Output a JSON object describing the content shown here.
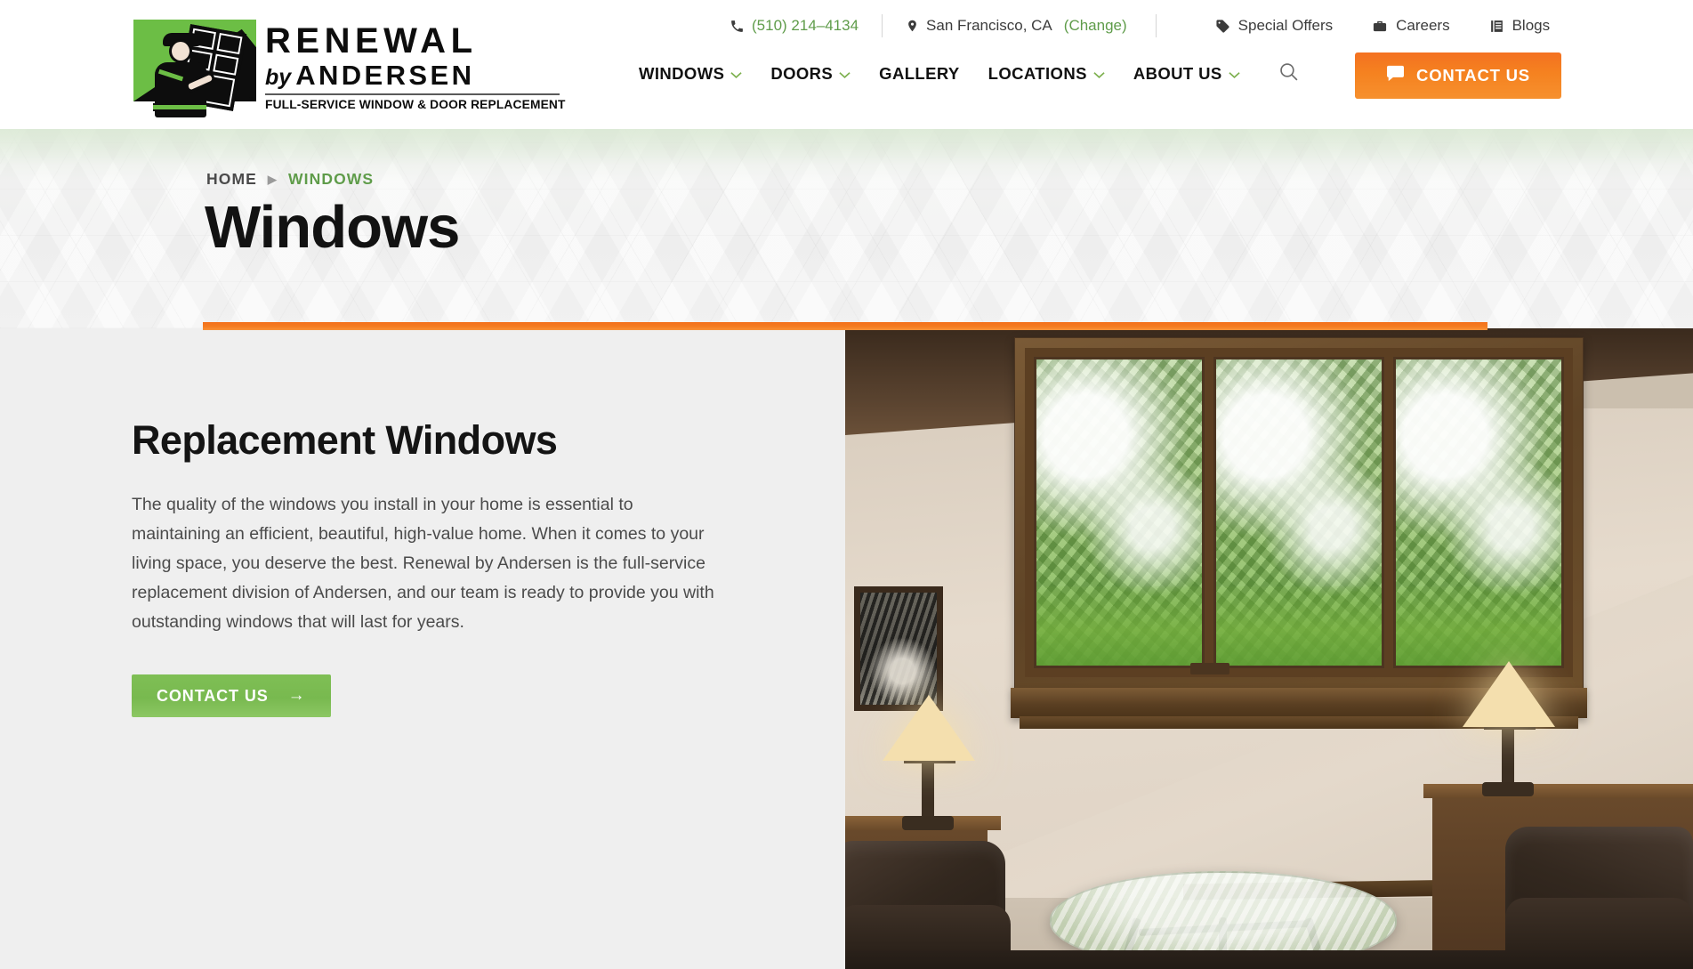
{
  "header": {
    "logo": {
      "brand_line1": "RENEWAL",
      "brand_by": "by",
      "brand_line2": "ANDERSEN",
      "tagline": "FULL-SERVICE WINDOW & DOOR REPLACEMENT",
      "trademark": "™"
    },
    "utility": {
      "phone": "(510) 214–4134",
      "location": "San Francisco, CA",
      "change_label": "(Change)",
      "links": [
        {
          "label": "Special Offers",
          "icon": "tag-icon"
        },
        {
          "label": "Careers",
          "icon": "briefcase-icon"
        },
        {
          "label": "Blogs",
          "icon": "book-icon"
        }
      ]
    },
    "nav": [
      {
        "label": "WINDOWS",
        "has_dropdown": true
      },
      {
        "label": "DOORS",
        "has_dropdown": true
      },
      {
        "label": "GALLERY",
        "has_dropdown": false
      },
      {
        "label": "LOCATIONS",
        "has_dropdown": true
      },
      {
        "label": "ABOUT US",
        "has_dropdown": true
      }
    ],
    "search_icon": "search-icon",
    "contact_button": {
      "label": "CONTACT US",
      "icon": "chat-bubble-icon",
      "color": "#F47721"
    }
  },
  "hero": {
    "breadcrumb": {
      "home": "HOME",
      "separator": "▶",
      "current": "WINDOWS"
    },
    "title": "Windows",
    "accent_color": "#F47721"
  },
  "main": {
    "heading": "Replacement Windows",
    "paragraph": "The quality of the windows you install in your home is essential to maintaining an efficient, beautiful, high-value home. When it comes to your living space, you deserve the best. Renewal by Andersen is the full-service replacement division of Andersen, and our team is ready to provide you with outstanding windows that will last for years.",
    "cta": {
      "label": "CONTACT US",
      "arrow": "→",
      "color": "#7FBF55"
    },
    "photo_alt": "Living room interior with large wood-framed replacement window overlooking a green garden"
  },
  "colors": {
    "green": "#5F9C4A",
    "orange": "#F47721",
    "panel_gray": "#EFEFEF"
  }
}
